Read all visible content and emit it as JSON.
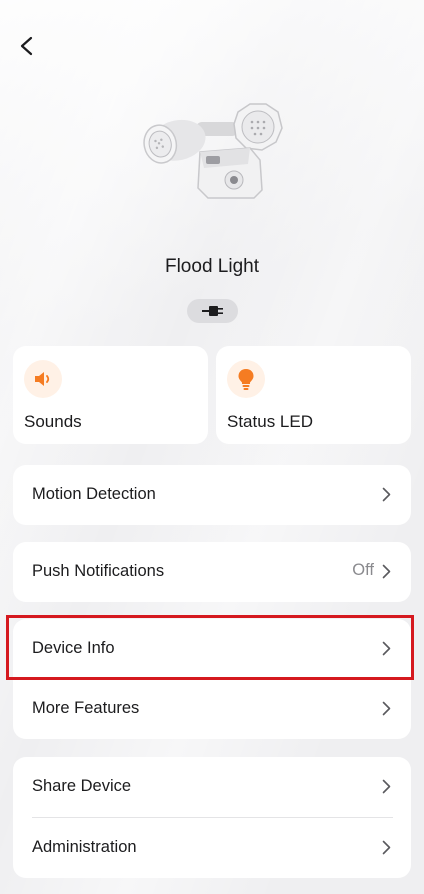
{
  "device": {
    "name": "Flood Light",
    "image": "flood-light-camera",
    "connection_icon": "plug-icon"
  },
  "tiles": [
    {
      "label": "Sounds",
      "icon": "speaker-icon",
      "icon_color": "#f57c22"
    },
    {
      "label": "Status LED",
      "icon": "bulb-icon",
      "icon_color": "#f57c22"
    }
  ],
  "rows": {
    "motion_detection": {
      "label": "Motion Detection"
    },
    "push_notifications": {
      "label": "Push Notifications",
      "value": "Off"
    },
    "device_info": {
      "label": "Device Info"
    },
    "more_features": {
      "label": "More Features"
    },
    "share_device": {
      "label": "Share Device"
    },
    "administration": {
      "label": "Administration"
    }
  },
  "colors": {
    "accent": "#f57c22",
    "highlight": "#d5191f",
    "background": "#efeff1",
    "card": "#ffffff"
  }
}
